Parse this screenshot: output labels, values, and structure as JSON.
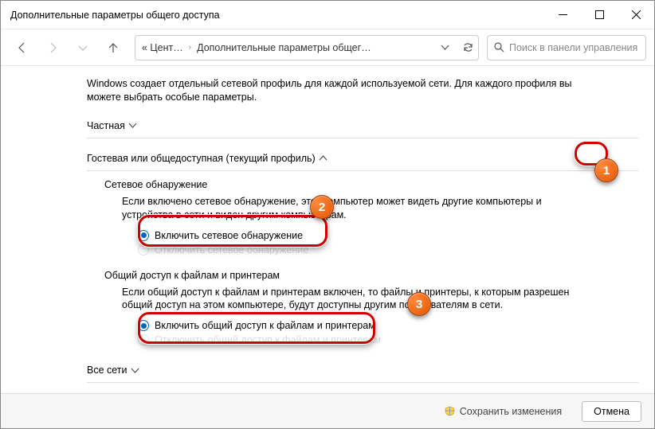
{
  "window": {
    "title": "Дополнительные параметры общего доступа"
  },
  "breadcrumb": {
    "root": "«  Цент…",
    "leaf": "Дополнительные параметры общег…"
  },
  "search": {
    "placeholder": "Поиск в панели управления"
  },
  "intro": "Windows создает отдельный сетевой профиль для каждой используемой сети. Для каждого профиля вы можете выбрать особые параметры.",
  "sections": {
    "private": {
      "title": "Частная"
    },
    "guest": {
      "title": "Гостевая или общедоступная (текущий профиль)",
      "discovery": {
        "title": "Сетевое обнаружение",
        "desc": "Если включено сетевое обнаружение, этот компьютер может видеть другие компьютеры и устройства в сети и виден другим компьютерам.",
        "radio_on": "Включить сетевое обнаружение",
        "radio_off": "Отключить сетевое обнаружение"
      },
      "sharing": {
        "title": "Общий доступ к файлам и принтерам",
        "desc": "Если общий доступ к файлам и принтерам включен, то файлы и принтеры, к которым разрешен общий доступ на этом компьютере, будут доступны другим пользователям в сети.",
        "radio_on": "Включить общий доступ к файлам и принтерам",
        "radio_off": "Отключить общий доступ к файлам и принтерам"
      }
    },
    "all": {
      "title": "Все сети"
    }
  },
  "footer": {
    "save": "Сохранить изменения",
    "cancel": "Отмена"
  },
  "badges": {
    "b1": "1",
    "b2": "2",
    "b3": "3"
  }
}
